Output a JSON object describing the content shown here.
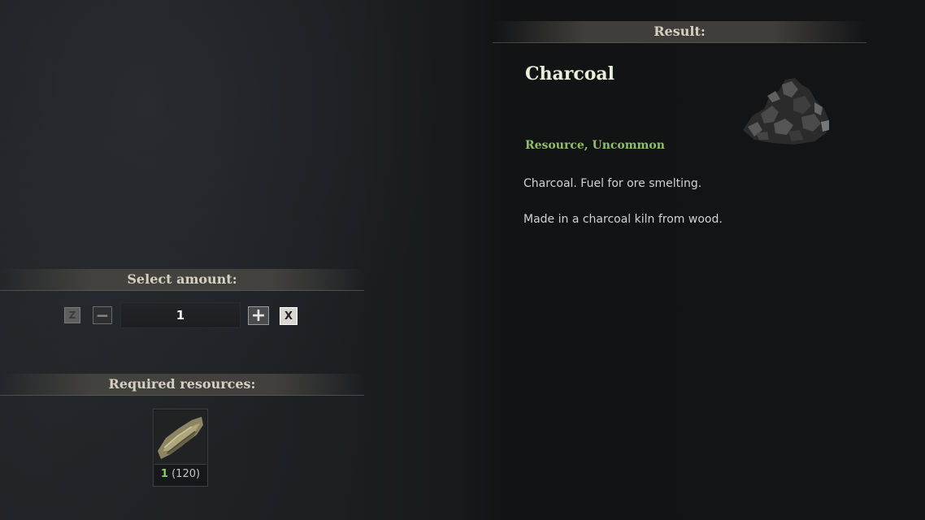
{
  "result": {
    "section_title": "Result:",
    "item_name": "Charcoal",
    "category": "Resource, Uncommon",
    "description_1": "Charcoal. Fuel for ore smelting.",
    "description_2": "Made in a charcoal kiln from wood.",
    "icon": "charcoal-pile-icon"
  },
  "amount": {
    "section_title": "Select amount:",
    "z_label": "Z",
    "minus_label": "−",
    "value": "1",
    "plus_label": "+",
    "x_label": "X"
  },
  "required": {
    "section_title": "Required resources:",
    "items": [
      {
        "icon": "wood-log-icon",
        "needed": "1",
        "available": "(120)"
      }
    ]
  },
  "colors": {
    "title_text": "#d6d0c2",
    "item_name": "#e6f0d8",
    "category": "#8fbf6a",
    "needed_count": "#8fd05a"
  }
}
